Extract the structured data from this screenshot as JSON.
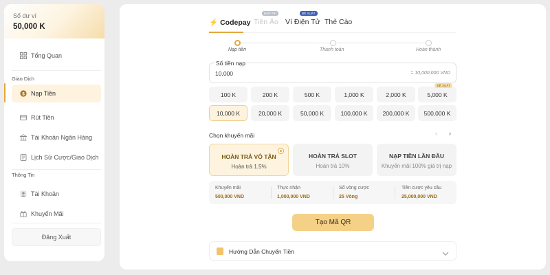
{
  "sidebar": {
    "balance_label": "Số dư ví",
    "balance_value": "50,000 K",
    "overview": "Tổng Quan",
    "section_transactions": "Giao Dịch",
    "deposit": "Nạp Tiền",
    "withdraw": "Rút Tiền",
    "bank_account": "Tài Khoản Ngân Hàng",
    "history": "Lịch Sử Cược/Giao Dịch",
    "section_info": "Thông Tin",
    "account": "Tài Khoản",
    "promotions": "Khuyến Mãi",
    "logout": "Đăng Xuất"
  },
  "tabs": {
    "codepay": "Codepay",
    "virtual": "Tiền Ảo",
    "virtual_badge": "BẢO TRÌ",
    "ewallet": "Ví Điện Tử",
    "ewallet_badge": "ĐỀ XUẤT",
    "card": "Thẻ Cào"
  },
  "stepper": {
    "step1": "Nạp tiền",
    "step2": "Thanh toán",
    "step3": "Hoàn thành"
  },
  "amount": {
    "label": "Số tiền nạp",
    "value": "10,000",
    "hint": "= 10,000,000 VND"
  },
  "quick_amounts": {
    "row1": [
      "100 K",
      "200 K",
      "500 K",
      "1,000 K",
      "2,000 K",
      "5,000 K"
    ],
    "row2": [
      "10,000 K",
      "20,000 K",
      "50,000 K",
      "100,000 K",
      "200,000 K",
      "500,000 K"
    ],
    "badge": "ĐỀ XUẤT"
  },
  "promo": {
    "title": "Chọn khuyến mãi",
    "cards": [
      {
        "name": "HOÀN TRẢ VÔ TẬN",
        "sub": "Hoàn trả 1.5%"
      },
      {
        "name": "HOÀN TRẢ SLOT",
        "sub": "Hoàn trả 10%"
      },
      {
        "name": "NẠP TIỀN LẦN ĐẦU",
        "sub": "Khuyến mãi 100% giá trị nạp"
      }
    ]
  },
  "summary": [
    {
      "label": "Khuyến mãi",
      "value": "500,000 VND"
    },
    {
      "label": "Thực nhận",
      "value": "1,000,000 VND"
    },
    {
      "label": "Số vòng cược",
      "value": "25 Vòng"
    },
    {
      "label": "Tiền cược yêu cầu",
      "value": "25,000,000 VND"
    }
  ],
  "qr_button": "Tạo Mã QR",
  "guide": "Hướng Dẫn Chuyển Tiền",
  "colors": {
    "accent": "#e2a73a",
    "accent_light": "#fdf3df",
    "button": "#f5d188",
    "value_text": "#9a6a12"
  }
}
